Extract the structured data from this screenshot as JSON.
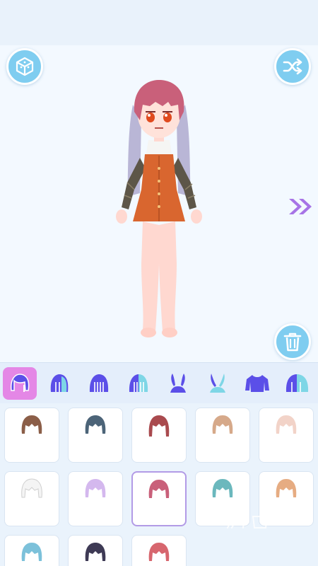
{
  "toolbar": {
    "box_icon": "cube-box-icon",
    "shuffle_icon": "shuffle-icon",
    "trash_icon": "trash-icon",
    "next_icon": "double-chevron-right-icon"
  },
  "colors": {
    "accent_blue": "#7fcdf0",
    "tab_active": "#e487e6",
    "tab_icon": "#5b4fe8",
    "selected_border": "#b29be6"
  },
  "categories": [
    {
      "icon": "hair-front-icon",
      "selected": true
    },
    {
      "icon": "hair-back-icon",
      "selected": false
    },
    {
      "icon": "bangs-icon",
      "selected": false
    },
    {
      "icon": "hair-side-icon",
      "selected": false
    },
    {
      "icon": "bunny-ears-icon",
      "selected": false
    },
    {
      "icon": "ribbon-ears-icon",
      "selected": false
    },
    {
      "icon": "sweater-icon",
      "selected": false
    },
    {
      "icon": "hair-color-icon",
      "selected": false
    }
  ],
  "hair_options": [
    {
      "color": "#8b5e48",
      "selected": false
    },
    {
      "color": "#4c6478",
      "selected": false
    },
    {
      "color": "#a94a4e",
      "selected": false
    },
    {
      "color": "#d6a98a",
      "selected": false
    },
    {
      "color": "#f2d3c8",
      "selected": false
    },
    {
      "color": "#f1f1f1",
      "selected": false
    },
    {
      "color": "#d4b8ee",
      "selected": false
    },
    {
      "color": "#c9607a",
      "selected": true
    },
    {
      "color": "#6bb8bd",
      "selected": false
    },
    {
      "color": "#e6ac82",
      "selected": false
    },
    {
      "color": "#7cc1da",
      "selected": false
    },
    {
      "color": "#3e3a55",
      "selected": false
    },
    {
      "color": "#d7666e",
      "selected": false
    }
  ]
}
